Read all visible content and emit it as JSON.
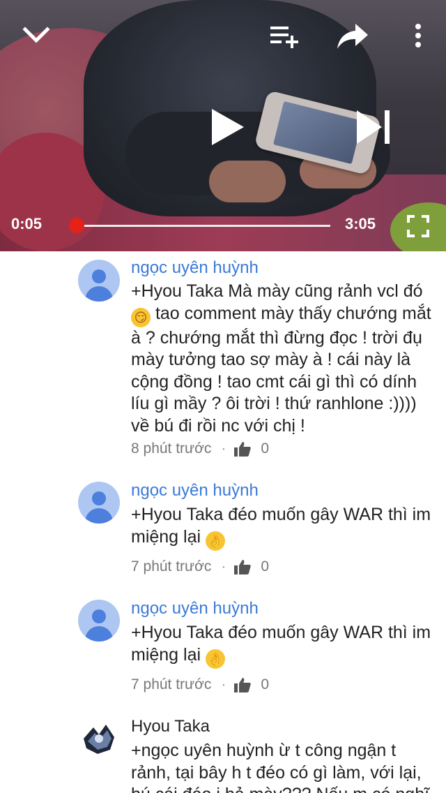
{
  "player": {
    "current_time": "0:05",
    "duration": "3:05",
    "progress": 0.027,
    "icons": [
      "chevron-down-icon",
      "add-to-queue-icon",
      "share-icon",
      "more-vert-icon",
      "play-icon",
      "skip-next-icon",
      "fullscreen-icon"
    ],
    "accent_color": "#e62117"
  },
  "comments": [
    {
      "author": "ngọc uyên huỳnh",
      "text_before_emoji": "+Hyou Taka Mà mày cũng rảnh vcl đó ",
      "emoji": "😏",
      "text_after_emoji": " tao comment mày thấy chướng mắt à ? chướng mắt thì đừng đọc ! trời đụ mày tưởng tao sợ mày à ! cái này là cộng đồng ! tao cmt cái gì thì có dính líu gì mầy ? ôi trời ! thứ ranhlone :)))) về bú đi rồi nc với chị !",
      "time": "8 phút trước",
      "likes": "0"
    },
    {
      "author": "ngọc uyên huỳnh",
      "text_before_emoji": "+Hyou Taka đéo muốn gây WAR thì im miệng lại ",
      "emoji": "👌",
      "text_after_emoji": "",
      "time": "7 phút trước",
      "likes": "0"
    },
    {
      "author": "ngọc uyên huỳnh",
      "text_before_emoji": "+Hyou Taka đéo muốn gây WAR thì im miệng lại ",
      "emoji": "👌",
      "text_after_emoji": "",
      "time": "7 phút trước",
      "likes": "0"
    },
    {
      "author": "Hyou Taka",
      "text_before_emoji": "+ngọc uyên huỳnh ừ t công ngận t rảnh, tại bây h t đéo có gì làm, với lại, bú cái đéo j hả mày??? Nếu m có nghĩ",
      "emoji": "",
      "text_after_emoji": "",
      "time": "",
      "likes": ""
    }
  ],
  "colors": {
    "author_link": "#3a79d8",
    "avatar_bg": "#aec6f2",
    "avatar_fg": "#4d7fdc"
  }
}
